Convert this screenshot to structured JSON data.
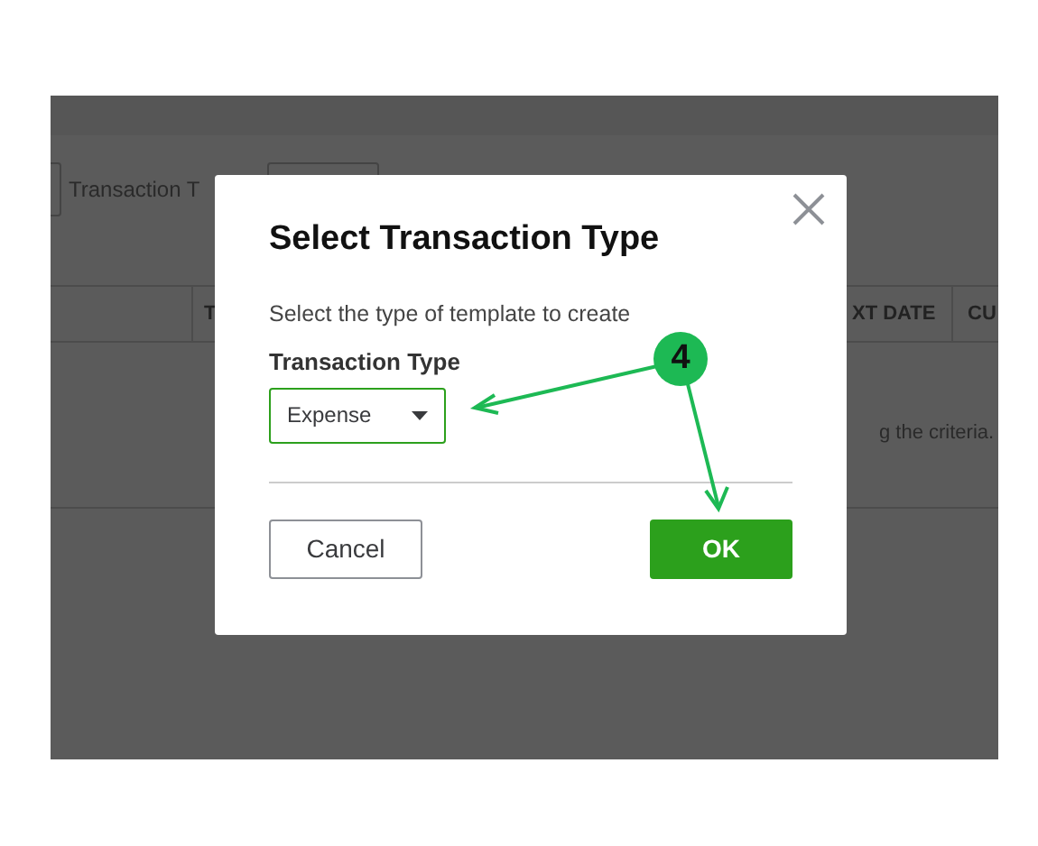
{
  "background": {
    "filter_label": "Transaction T",
    "table_columns": [
      "T",
      "XT DATE",
      "CU"
    ],
    "empty_message": "g the criteria."
  },
  "dialog": {
    "title": "Select Transaction Type",
    "subtitle": "Select the type of template to create",
    "field": {
      "label": "Transaction Type",
      "value": "Expense"
    },
    "buttons": [
      {
        "label": "Cancel",
        "kind": "secondary"
      },
      {
        "label": "OK",
        "kind": "primary"
      }
    ]
  },
  "annotation": {
    "step": "4"
  }
}
